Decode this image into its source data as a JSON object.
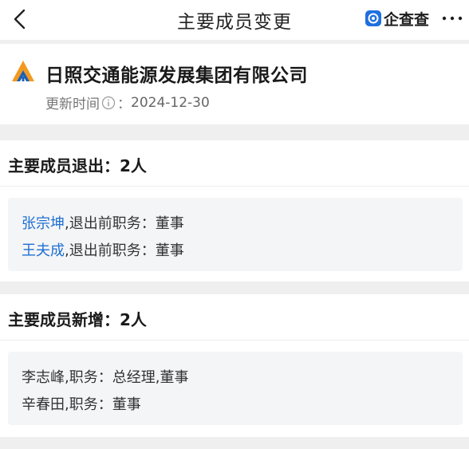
{
  "nav": {
    "title": "主要成员变更",
    "brand": "企查查",
    "back_icon": "chevron-left-icon",
    "more_icon": "more-dots-icon"
  },
  "company": {
    "name": "日照交通能源发展集团有限公司",
    "update_label": "更新时间",
    "update_sep": "：",
    "update_value": "2024-12-30"
  },
  "exits": {
    "heading": "主要成员退出：2人",
    "items": [
      {
        "name": "张宗坤",
        "detail": ",退出前职务：董事"
      },
      {
        "name": "王夫成",
        "detail": ",退出前职务：董事"
      }
    ]
  },
  "additions": {
    "heading": "主要成员新增：2人",
    "items": [
      {
        "name": "李志峰",
        "detail": ",职务：总经理,董事"
      },
      {
        "name": "辛春田",
        "detail": ",职务：董事"
      }
    ]
  },
  "colors": {
    "link": "#1f6fd1",
    "brand_blue": "#1e6fe0",
    "logo_orange": "#f29a1f",
    "logo_blue": "#1d5fb0"
  }
}
